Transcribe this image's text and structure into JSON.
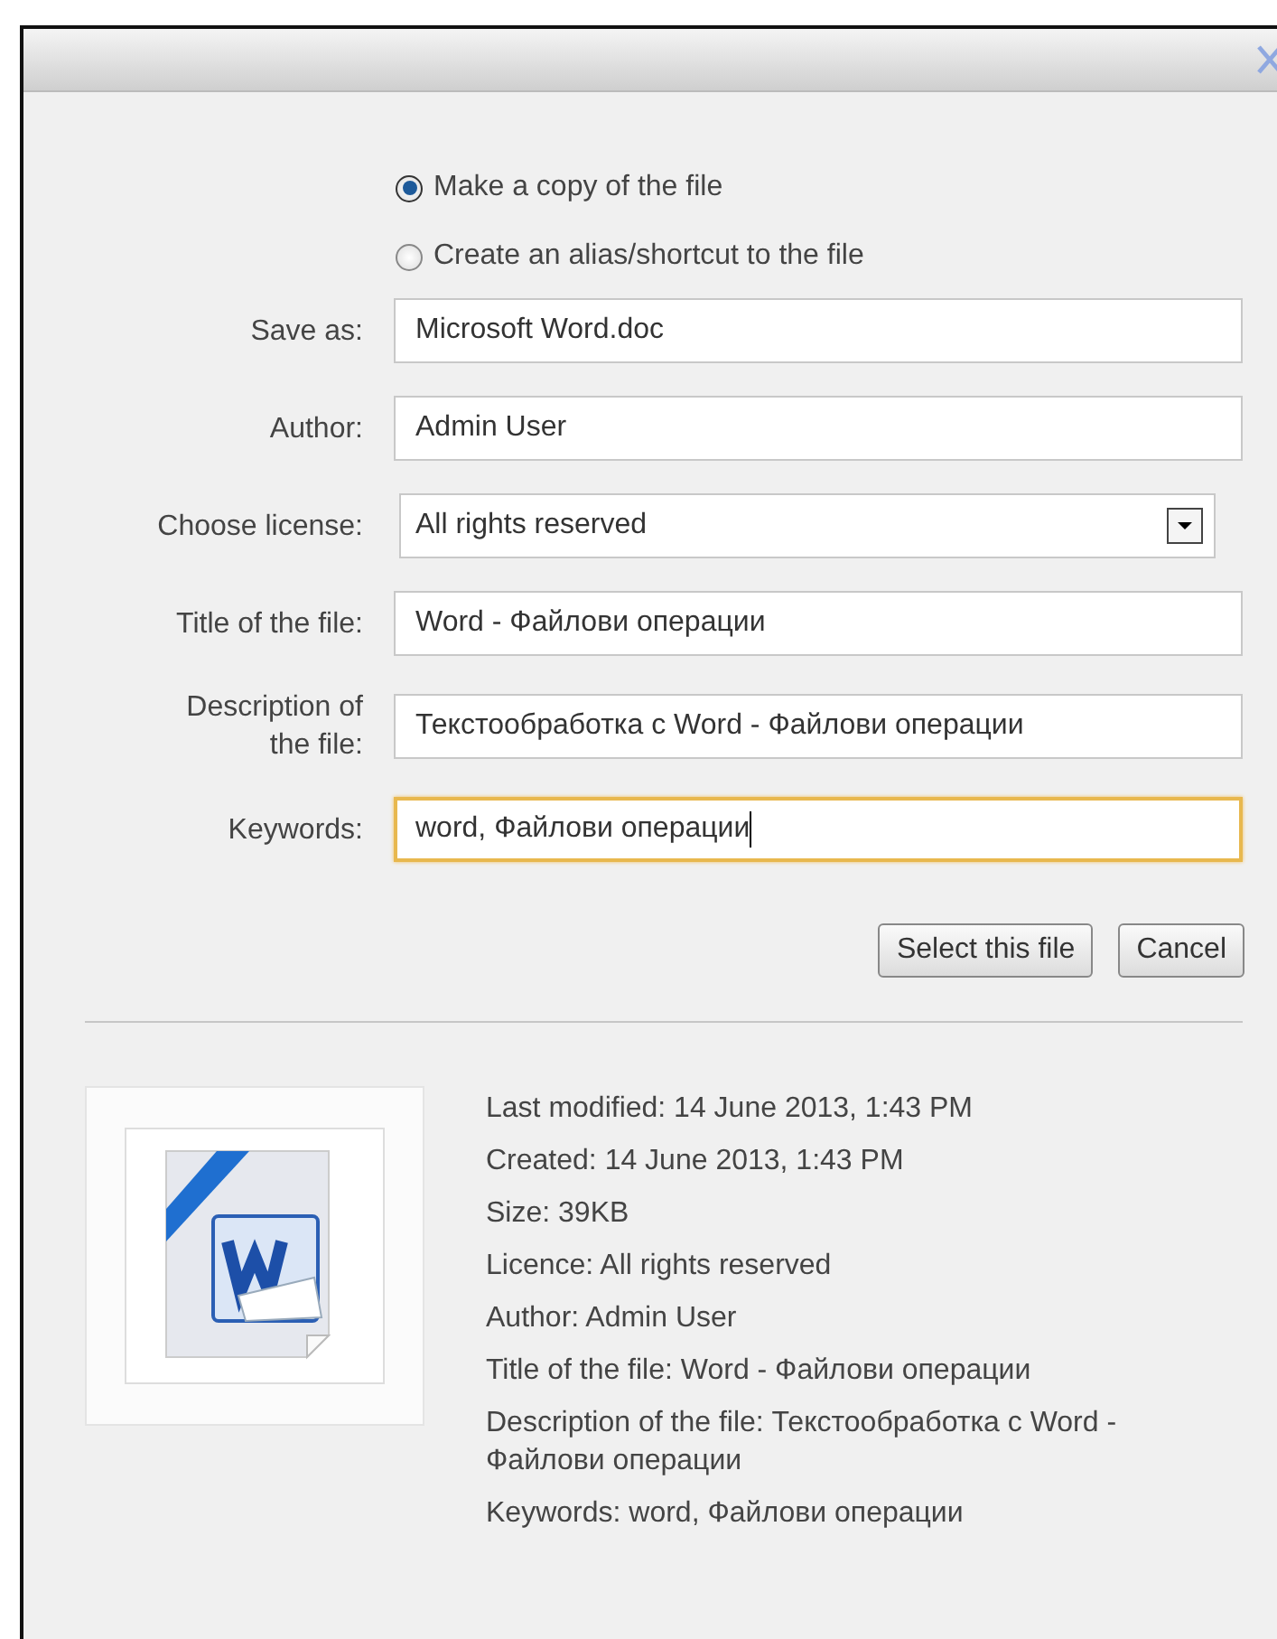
{
  "options": [
    {
      "label": "Make a copy of the file",
      "selected": true
    },
    {
      "label": "Create an alias/shortcut to the file",
      "selected": false
    }
  ],
  "fields": [
    {
      "kind": "text",
      "label": "Save as:",
      "value": "Microsoft Word.doc",
      "focused": false
    },
    {
      "kind": "text",
      "label": "Author:",
      "value": "Admin User",
      "focused": false
    },
    {
      "kind": "select",
      "label": "Choose license:",
      "value": "All rights reserved"
    },
    {
      "kind": "text",
      "label": "Title of the file:",
      "value": "Word - Файлови операции",
      "focused": false
    },
    {
      "kind": "text",
      "label": "Description of the file:",
      "value": "Текстообработка с Word - Файлови операции",
      "focused": false
    },
    {
      "kind": "text",
      "label": "Keywords:",
      "value": "word, Файлови операции",
      "focused": true
    }
  ],
  "buttons": [
    "Select this file",
    "Cancel"
  ],
  "details": [
    "Last modified: 14 June 2013, 1:43 PM",
    "Created: 14 June 2013, 1:43 PM",
    "Size: 39KB",
    "Licence: All rights reserved",
    "Author: Admin User",
    "Title of the file: Word - Файлови операции",
    "Description of the file: Текстообработка с Word - Файлови операции",
    "Keywords: word, Файлови операции"
  ]
}
